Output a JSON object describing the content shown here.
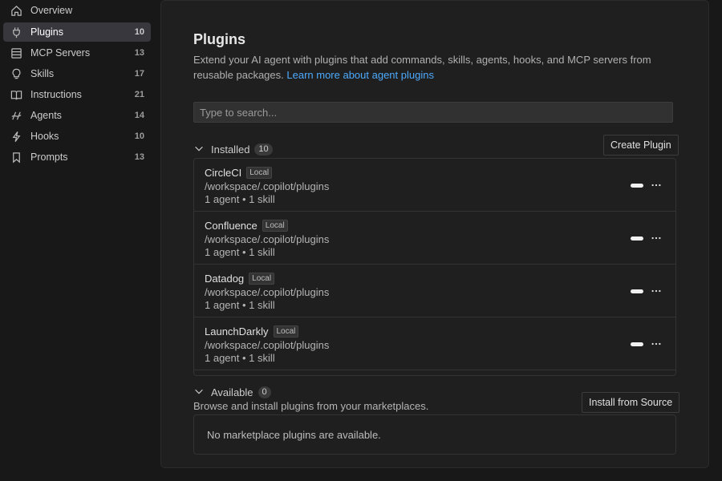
{
  "sidebar": {
    "items": [
      {
        "label": "Overview",
        "count": "",
        "icon": "home-icon"
      },
      {
        "label": "Plugins",
        "count": "10",
        "icon": "plug-icon",
        "active": true
      },
      {
        "label": "MCP Servers",
        "count": "13",
        "icon": "server-icon"
      },
      {
        "label": "Skills",
        "count": "17",
        "icon": "lightbulb-icon"
      },
      {
        "label": "Instructions",
        "count": "21",
        "icon": "book-icon"
      },
      {
        "label": "Agents",
        "count": "14",
        "icon": "agent-icon"
      },
      {
        "label": "Hooks",
        "count": "10",
        "icon": "lightning-icon"
      },
      {
        "label": "Prompts",
        "count": "13",
        "icon": "bookmark-icon"
      }
    ]
  },
  "main": {
    "title": "Plugins",
    "description": "Extend your AI agent with plugins that add commands, skills, agents, hooks, and MCP servers from reusable packages.",
    "learn_more": "Learn more about agent plugins",
    "search_placeholder": "Type to search...",
    "installed": {
      "label": "Installed",
      "count": "10",
      "create_button": "Create Plugin",
      "plugins": [
        {
          "name": "CircleCI",
          "tag": "Local",
          "path": "/workspace/.copilot/plugins",
          "summary": "1 agent • 1 skill",
          "enabled": true
        },
        {
          "name": "Confluence",
          "tag": "Local",
          "path": "/workspace/.copilot/plugins",
          "summary": "1 agent • 1 skill",
          "enabled": true
        },
        {
          "name": "Datadog",
          "tag": "Local",
          "path": "/workspace/.copilot/plugins",
          "summary": "1 agent • 1 skill",
          "enabled": true
        },
        {
          "name": "LaunchDarkly",
          "tag": "Local",
          "path": "/workspace/.copilot/plugins",
          "summary": "1 agent • 1 skill",
          "enabled": true
        }
      ]
    },
    "available": {
      "label": "Available",
      "count": "0",
      "install_button": "Install from Source",
      "description": "Browse and install plugins from your marketplaces.",
      "empty_message": "No marketplace plugins are available."
    }
  },
  "colors": {
    "accent_link": "#4daafc",
    "active_nav_bg": "#37373d",
    "background": "#181818",
    "panel": "#1f1f1f"
  }
}
